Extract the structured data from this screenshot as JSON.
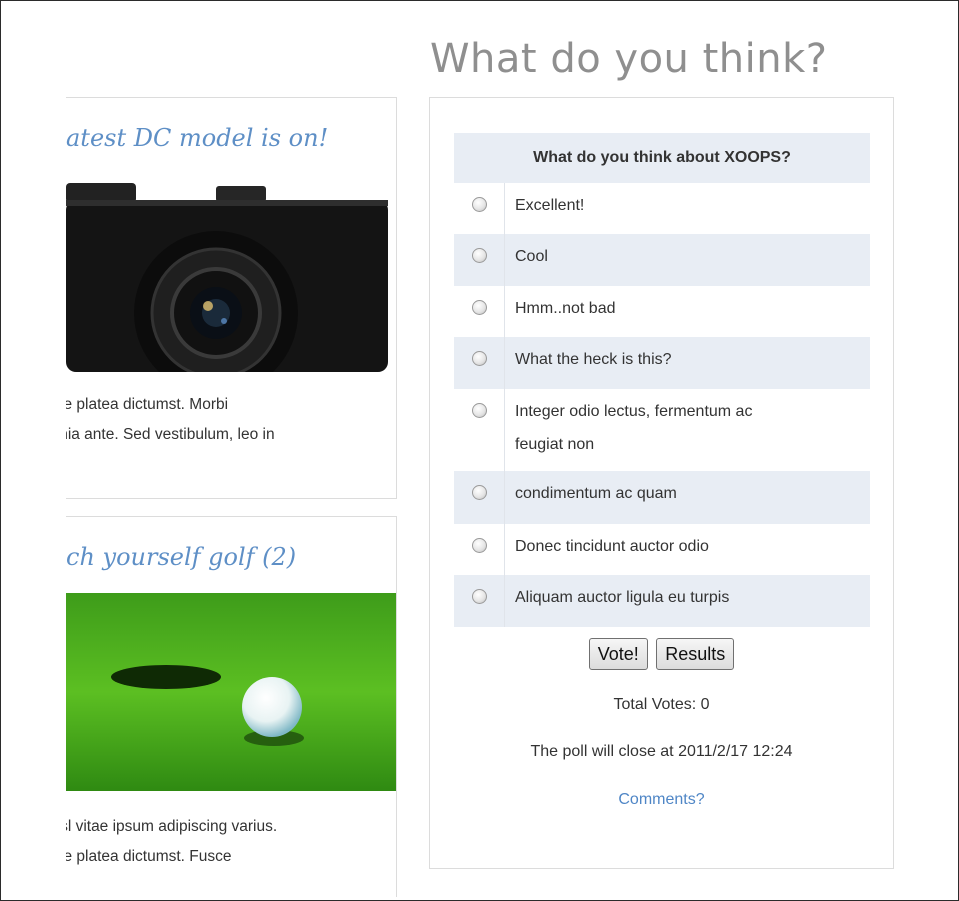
{
  "articles": [
    {
      "title": "atest DC model is on!",
      "image": "camera-photo",
      "text_lines": [
        "sse platea dictumst. Morbi",
        "cinia ante. Sed vestibulum, leo in"
      ]
    },
    {
      "title": "ch yourself golf (2)",
      "image": "golf-ball-photo",
      "text_lines": [
        "nisl vitae ipsum adipiscing varius.",
        "sse platea dictumst. Fusce"
      ]
    }
  ],
  "poll": {
    "heading": "What do you think?",
    "question": "What do you think about XOOPS?",
    "options": [
      {
        "line1": "Excellent!",
        "line2": ""
      },
      {
        "line1": "Cool",
        "line2": ""
      },
      {
        "line1": "Hmm..not bad",
        "line2": ""
      },
      {
        "line1": "What the heck is this?",
        "line2": ""
      },
      {
        "line1": "Integer odio lectus, fermentum ac",
        "line2": "feugiat non"
      },
      {
        "line1": "condimentum ac quam",
        "line2": ""
      },
      {
        "line1": "Donec tincidunt auctor odio",
        "line2": ""
      },
      {
        "line1": "Aliquam auctor ligula eu turpis",
        "line2": ""
      }
    ],
    "vote_label": "Vote!",
    "results_label": "Results",
    "total_votes": "Total Votes: 0",
    "closes_at": "The poll will close at 2011/2/17 12:24",
    "comments_link": "Comments?"
  },
  "colors": {
    "accent": "#5e8fc6",
    "row_alt": "#e8edf4",
    "heading": "#8f8f8f"
  }
}
